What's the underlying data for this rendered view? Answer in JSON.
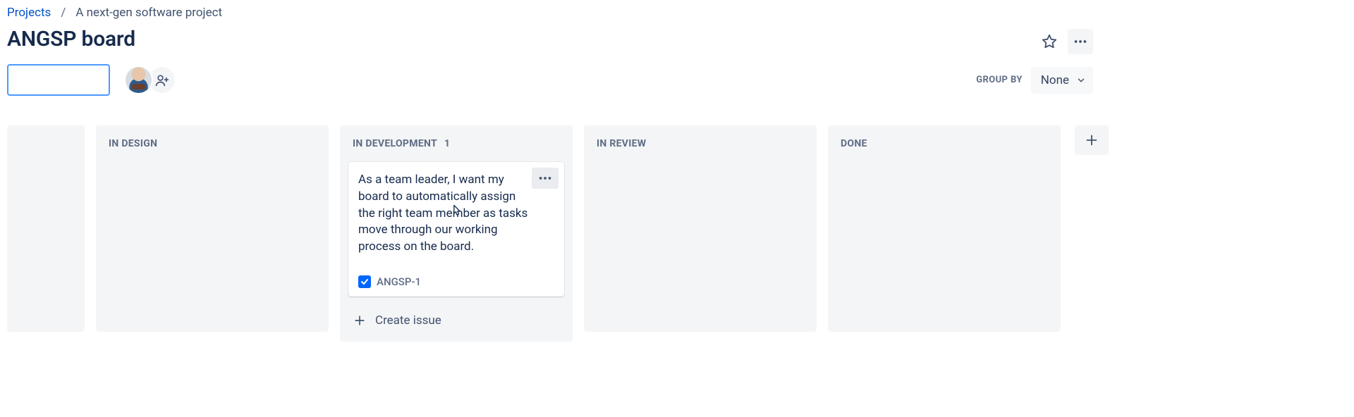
{
  "breadcrumb": {
    "root": "Projects",
    "project": "A next-gen software project"
  },
  "title": "ANGSP board",
  "toolbar": {
    "search_value": "",
    "group_by_label": "GROUP BY",
    "group_by_value": "None"
  },
  "columns": [
    {
      "id": "in-design",
      "name": "IN DESIGN",
      "count": null,
      "cards": []
    },
    {
      "id": "in-development",
      "name": "IN DEVELOPMENT",
      "count": "1",
      "cards": [
        {
          "summary": "As a team leader, I want my board to automatically assign the right team member as tasks move through our working process on the board.",
          "type": "task",
          "key": "ANGSP-1"
        }
      ],
      "create_label": "Create issue"
    },
    {
      "id": "in-review",
      "name": "IN REVIEW",
      "count": null,
      "cards": []
    },
    {
      "id": "done",
      "name": "DONE",
      "count": null,
      "cards": []
    }
  ]
}
